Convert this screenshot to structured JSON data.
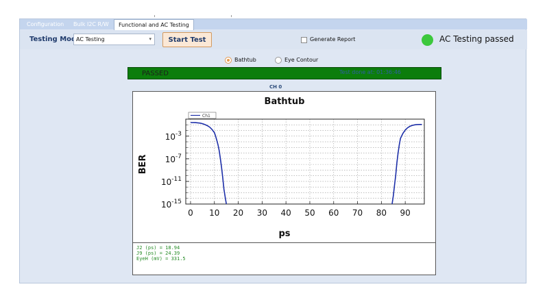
{
  "tabs": [
    {
      "label": "Configuration",
      "active": false
    },
    {
      "label": "Bulk I2C R/W",
      "active": false
    },
    {
      "label": "Functional and AC Testing",
      "active": true
    }
  ],
  "toolbar": {
    "mode_label": "Testing Mode",
    "mode_value": "AC Testing",
    "start_label": "Start Test",
    "report_label": "Generate Report",
    "report_checked": false,
    "status_text": "AC Testing passed",
    "status_color": "#3cc83c"
  },
  "view": {
    "options": [
      {
        "label": "Bathtub",
        "selected": true
      },
      {
        "label": "Eye Contour",
        "selected": false
      }
    ]
  },
  "result": {
    "text": "PASSED",
    "time": "Test done at: 01:36:46",
    "color": "#0c7d0c"
  },
  "channel_label": "CH 0",
  "chart_data": {
    "type": "line",
    "title": "Bathtub",
    "xlabel": "ps",
    "ylabel": "BER",
    "y_scale": "log",
    "xlim": [
      -2,
      98
    ],
    "ylim": [
      1e-15,
      1
    ],
    "x_ticks": [
      "0",
      "10",
      "20",
      "30",
      "40",
      "50",
      "60",
      "70",
      "80",
      "90"
    ],
    "x_tick_values": [
      0,
      10,
      20,
      30,
      40,
      50,
      60,
      70,
      80,
      90
    ],
    "y_ticks": [
      "10",
      "10",
      "10",
      "10"
    ],
    "y_tick_exponents": [
      "-3",
      "-7",
      "-11",
      "-15"
    ],
    "y_tick_values": [
      0.001,
      1e-07,
      1e-11,
      1e-15
    ],
    "grid": true,
    "legend": "top-left",
    "series": [
      {
        "name": "Ch1",
        "color": "#1c2ea8",
        "left_edge": {
          "x": [
            0,
            2,
            4,
            5,
            6,
            7,
            8,
            9,
            10,
            10.5,
            11,
            11.5,
            12,
            12.5,
            13,
            13.5,
            14,
            14.5,
            15
          ],
          "y": [
            0.25,
            0.24,
            0.2,
            0.16,
            0.11,
            0.07,
            0.04,
            0.015,
            0.004,
            0.001,
            0.0002,
            3e-05,
            3e-06,
            1e-07,
            3e-09,
            5e-11,
            4e-13,
            2e-14,
            1e-15
          ]
        },
        "right_edge": {
          "x": [
            84.5,
            85,
            85.5,
            86,
            86.5,
            87,
            87.5,
            88,
            89,
            90,
            91,
            92,
            93,
            94,
            95,
            96,
            97
          ],
          "y": [
            1e-15,
            3e-14,
            2e-12,
            1e-10,
            2e-08,
            1e-06,
            3e-05,
            0.0004,
            0.003,
            0.012,
            0.03,
            0.055,
            0.08,
            0.1,
            0.11,
            0.115,
            0.115
          ]
        }
      }
    ]
  },
  "metrics": {
    "j2": "J2 (ps) = 18.94",
    "j9": "J9 (ps) = 24.39",
    "eyeh": "EyeH (mV) = 331.5"
  }
}
